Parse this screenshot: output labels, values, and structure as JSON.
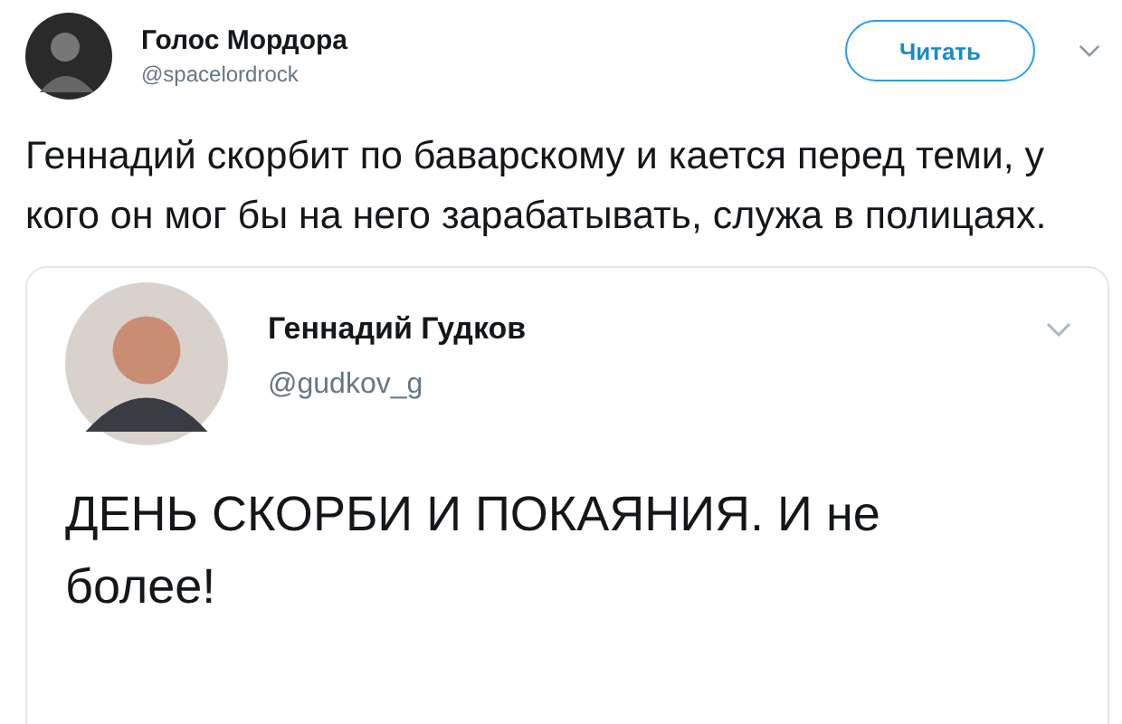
{
  "tweet": {
    "author": {
      "name": "Голос Мордора",
      "handle": "@spacelordrock"
    },
    "follow_button": "Читать",
    "text": "Геннадий скорбит по баварскому и кается перед теми, у кого он мог бы на него зарабатывать, служа в полицаях.",
    "quoted_tweet": {
      "author": {
        "name": "Геннадий Гудков",
        "handle": "@gudkov_g"
      },
      "text": "ДЕНЬ СКОРБИ И ПОКАЯНИЯ. И не более!"
    }
  }
}
